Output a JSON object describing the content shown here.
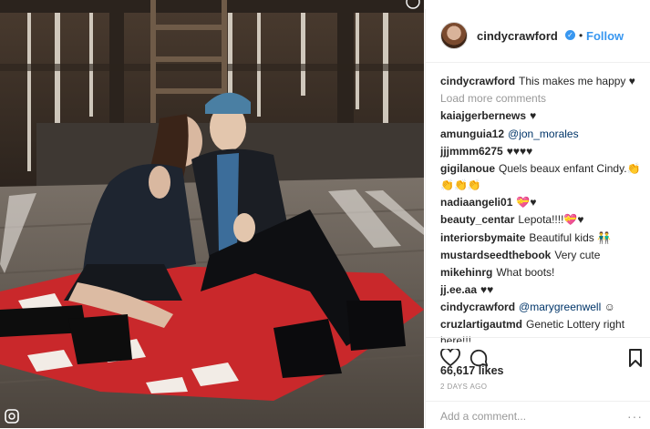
{
  "post": {
    "image_alt": "",
    "author": "cindycrawford",
    "verified_icon": "verified-badge-icon",
    "follow_sep": "•",
    "follow_label": "Follow",
    "likes": "66,617 likes",
    "time_ago": "2 DAYS AGO",
    "comment_placeholder": "Add a comment...",
    "more_label": "···"
  },
  "caption": {
    "user": "cindycrawford",
    "text": "This makes me happy ♥"
  },
  "load_more": "Load more comments",
  "comments": [
    {
      "user": "kaiajgerbernews",
      "text": "♥"
    },
    {
      "user": "amunguia12",
      "mention": "@jon_morales",
      "text": ""
    },
    {
      "user": "jjjmmm6275",
      "text": "♥♥♥♥"
    },
    {
      "user": "gigilanoue",
      "text": "Quels beaux enfant Cindy.👏👏👏👏"
    },
    {
      "user": "nadiaangeli01",
      "text": "💝♥"
    },
    {
      "user": "beauty_centar",
      "text": "Lepota!!!!💝♥"
    },
    {
      "user": "interiorsbymaite",
      "text": "Beautiful kids 👬"
    },
    {
      "user": "mustardseedthebook",
      "text": "Very cute"
    },
    {
      "user": "mikehinrg",
      "text": "What boots!"
    },
    {
      "user": "jj.ee.aa",
      "text": "♥♥"
    },
    {
      "user": "cindycrawford",
      "mention": "@marygreenwell",
      "text": "☺"
    },
    {
      "user": "cruzlartigautmd",
      "text": "Genetic Lottery right here!!!"
    }
  ],
  "icons": {
    "like": "heart-icon",
    "comment": "comment-icon",
    "save": "bookmark-icon"
  },
  "colors": {
    "accent": "#3897f0",
    "text": "#262626",
    "muted": "#999999",
    "mention": "#003569"
  }
}
